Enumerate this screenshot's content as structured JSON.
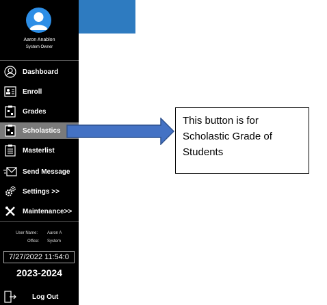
{
  "user": {
    "name": "Aaron Anablon",
    "role": "System Owner"
  },
  "nav": {
    "items": [
      {
        "label": "Dashboard",
        "icon": "dashboard-icon"
      },
      {
        "label": "Enroll",
        "icon": "id-card-icon"
      },
      {
        "label": "Grades",
        "icon": "grades-icon"
      },
      {
        "label": "Scholastics",
        "icon": "scholastics-icon",
        "active": true
      },
      {
        "label": "Masterlist",
        "icon": "clipboard-list-icon"
      },
      {
        "label": "Send Message",
        "icon": "envelope-icon"
      },
      {
        "label": "Settings >>",
        "icon": "gears-icon"
      },
      {
        "label": "Maintenance>>",
        "icon": "tools-icon"
      }
    ]
  },
  "info": {
    "username_label": "User Name:",
    "username_value": "Aaron A",
    "office_label": "Office:",
    "office_value": "System"
  },
  "datetime": "7/27/2022 11:54:0",
  "school_year": "2023-2024",
  "logout_label": "Log Out",
  "annotation": {
    "text": "This button is for Scholastic Grade of Students"
  },
  "colors": {
    "sidebar_bg": "#000000",
    "active_item_bg": "#7a7a7a",
    "header_blue": "#2e7bc0",
    "avatar_blue": "#2d8ee6",
    "arrow_fill": "#4472c4",
    "arrow_stroke": "#2f528f"
  }
}
